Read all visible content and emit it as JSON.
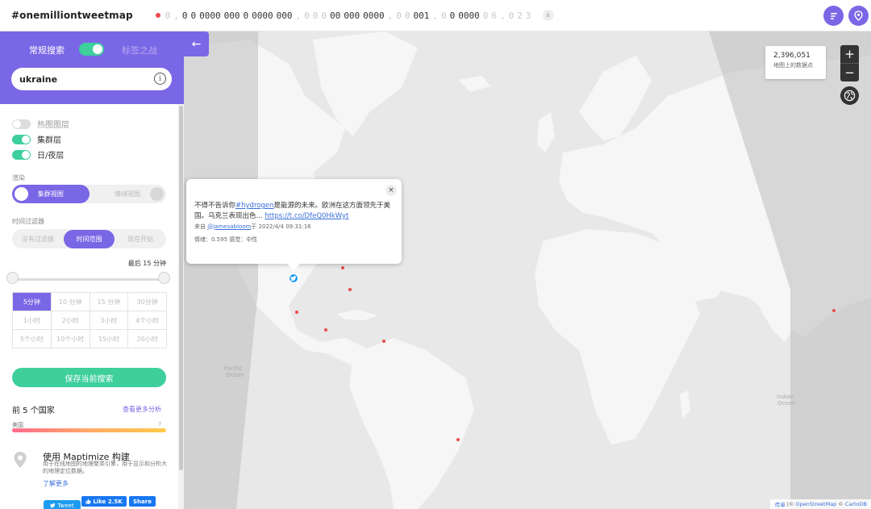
{
  "header": {
    "logo": "#onemilliontweetmap",
    "counter_parts": [
      {
        "t": "0",
        "dim": true
      },
      {
        "t": ",",
        "dim": true
      },
      {
        "t": "0",
        "dim": false
      },
      {
        "t": "0",
        "dim": false
      },
      {
        "t": "0000",
        "dim": false
      },
      {
        "t": "000",
        "dim": false
      },
      {
        "t": "0",
        "dim": false
      },
      {
        "t": "0000",
        "dim": false
      },
      {
        "t": "000",
        "dim": false
      },
      {
        "t": ",",
        "dim": true
      },
      {
        "t": "0",
        "dim": true
      },
      {
        "t": "0",
        "dim": true
      },
      {
        "t": "0",
        "dim": true
      },
      {
        "t": "00",
        "dim": false
      },
      {
        "t": "000",
        "dim": false
      },
      {
        "t": "0000",
        "dim": false
      },
      {
        "t": ",",
        "dim": true
      },
      {
        "t": "0",
        "dim": true
      },
      {
        "t": "0",
        "dim": true
      },
      {
        "t": "001",
        "dim": false
      },
      {
        "t": ",",
        "dim": true
      },
      {
        "t": "0",
        "dim": true
      },
      {
        "t": "0",
        "dim": false
      },
      {
        "t": "0000",
        "dim": false
      },
      {
        "t": "0",
        "dim": true
      },
      {
        "t": "6",
        "dim": true
      },
      {
        "t": ",",
        "dim": true
      },
      {
        "t": "0",
        "dim": true
      },
      {
        "t": "2",
        "dim": true
      },
      {
        "t": "3",
        "dim": true
      }
    ],
    "pause_glyph": "II",
    "menu_icon": "list-icon",
    "location_icon": "location-pin-icon"
  },
  "sidebar": {
    "mode_normal": "常规搜索",
    "mode_tag": "标签之战",
    "search_value": "ukraine",
    "info_glyph": "i",
    "collapse_glyph": "←",
    "layers": [
      {
        "label": "热图图层",
        "on": false
      },
      {
        "label": "集群层",
        "on": true
      },
      {
        "label": "日/夜层",
        "on": true
      }
    ],
    "render_label": "渲染",
    "render_options": [
      {
        "label": "集群视图",
        "active": true
      },
      {
        "label": "情绪视图",
        "active": false
      }
    ],
    "time_filter_label": "时间过滤器",
    "time_filter_options": [
      {
        "label": "没有过滤器",
        "active": false
      },
      {
        "label": "时间范围",
        "active": true
      },
      {
        "label": "现在开始",
        "active": false
      }
    ],
    "last_label": "最后 15 分钟",
    "time_cells": [
      {
        "label": "5分钟",
        "active": true
      },
      {
        "label": "10 分钟",
        "active": false
      },
      {
        "label": "15 分钟",
        "active": false
      },
      {
        "label": "30分钟",
        "active": false
      },
      {
        "label": "1小时",
        "active": false
      },
      {
        "label": "2小时",
        "active": false
      },
      {
        "label": "3小时",
        "active": false
      },
      {
        "label": "4个小时",
        "active": false
      },
      {
        "label": "5个小时",
        "active": false
      },
      {
        "label": "10个小时",
        "active": false
      },
      {
        "label": "15小时",
        "active": false
      },
      {
        "label": "20小时",
        "active": false
      }
    ],
    "save_button": "保存当前搜索",
    "top5_title": "前 5 个国家",
    "more_link": "查看更多分析",
    "top_country": {
      "name": "美国",
      "value": "7"
    },
    "built_title": "使用 Maptimize 构建",
    "built_desc": "用于在线地图的地理聚类引擎，用于显示和分析大的地理定位数据。",
    "learn_more": "了解更多",
    "tweet_button": "Tweet",
    "like_button": "Like 2.5K",
    "share_button": "Share"
  },
  "map": {
    "count_value": "2,396,051",
    "count_label": "地图上的数据点",
    "zoom_in": "+",
    "zoom_out": "−",
    "attribution_prefix": "传单",
    "attribution_osm": "OpenStreetMap",
    "attribution_carto": "CartoDB",
    "popup": {
      "text_before": "不得不告诉你",
      "hashtag": "#hydrogen",
      "text_after": "是能源的未来。欧洲在这方面领先于美国。乌克兰表现出色...",
      "link": "https://t.co/DfeQ0HkWyt",
      "from_prefix": "来自",
      "user": "@jamesabloom",
      "from_suffix": "于 2022/4/4 09:31:16",
      "sentiment": "情绪：0.595 感觉：中性",
      "close_glyph": "×"
    },
    "colors": {
      "accent": "#7a67e6",
      "green": "#3ecf9c",
      "twitter": "#1d9bf0",
      "night": "#c4c4c4",
      "land": "#f6f6f6",
      "ocean": "#e8e8e8"
    }
  }
}
